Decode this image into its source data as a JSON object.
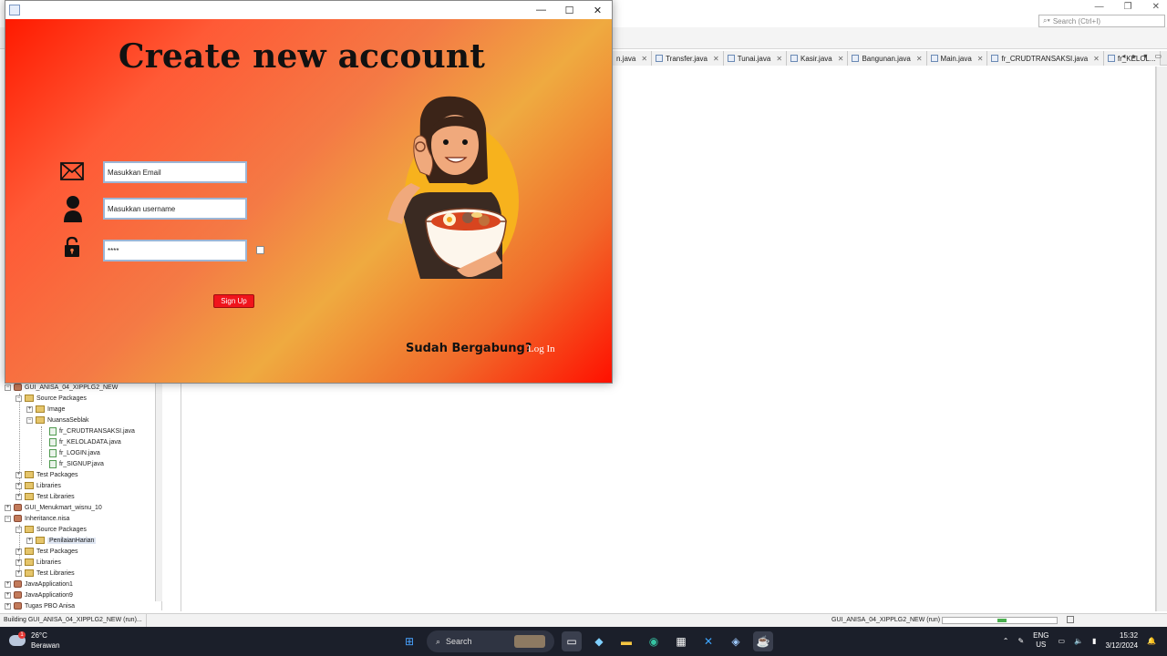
{
  "ide": {
    "search_placeholder": "Search (Ctrl+I)",
    "editor_tabs": [
      {
        "label": "n.java"
      },
      {
        "label": "Transfer.java"
      },
      {
        "label": "Tunai.java"
      },
      {
        "label": "Kasir.java"
      },
      {
        "label": "Bangunan.java"
      },
      {
        "label": "Main.java"
      },
      {
        "label": "fr_CRUDTRANSAKSI.java"
      },
      {
        "label": "fr_KELOL..."
      }
    ],
    "project_tree": [
      {
        "label": "GUI_ANISA_04_XIPPLG2_NEW",
        "type": "project"
      },
      {
        "label": "Source Packages",
        "type": "folder"
      },
      {
        "label": "Image",
        "type": "package"
      },
      {
        "label": "NuansaSeblak",
        "type": "package"
      },
      {
        "label": "fr_CRUDTRANSAKSI.java",
        "type": "file"
      },
      {
        "label": "fr_KELOLADATA.java",
        "type": "file"
      },
      {
        "label": "fr_LOGIN.java",
        "type": "file"
      },
      {
        "label": "fr_SIGNUP.java",
        "type": "file"
      },
      {
        "label": "Test Packages",
        "type": "folder"
      },
      {
        "label": "Libraries",
        "type": "folder"
      },
      {
        "label": "Test Libraries",
        "type": "folder"
      },
      {
        "label": "GUI_Menukmart_wisnu_10",
        "type": "project"
      },
      {
        "label": "Inheritance.nisa",
        "type": "project"
      },
      {
        "label": "Source Packages",
        "type": "folder"
      },
      {
        "label": "PenilaianHarian",
        "type": "package"
      },
      {
        "label": "Test Packages",
        "type": "folder"
      },
      {
        "label": "Libraries",
        "type": "folder"
      },
      {
        "label": "Test Libraries",
        "type": "folder"
      },
      {
        "label": "JavaApplication1",
        "type": "project"
      },
      {
        "label": "JavaApplication9",
        "type": "project"
      },
      {
        "label": "Tugas PBO Anisa",
        "type": "project"
      }
    ],
    "status_left": "Building GUI_ANISA_04_XIPPLG2_NEW (run)...",
    "status_right": "GUI_ANISA_04_XIPPLG2_NEW (run)",
    "build_progress": 0.1
  },
  "signup_window": {
    "title": "Create new account",
    "email_value": "Masukkan Email",
    "username_value": "Masukkan username",
    "password_value": "****",
    "signup_button": "Sign Up",
    "already_text": "Sudah Bergabung?",
    "login_link": "Log In",
    "gradient_colors": [
      "#ff1a00",
      "#f47a45",
      "#efaa40",
      "#ff1000"
    ]
  },
  "taskbar": {
    "temperature": "26°C",
    "weather": "Berawan",
    "weather_badge": "1",
    "search_label": "Search",
    "lang_1": "ENG",
    "lang_2": "US",
    "time": "15:32",
    "date": "3/12/2024"
  }
}
